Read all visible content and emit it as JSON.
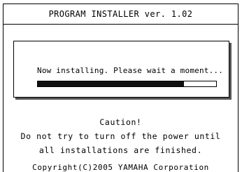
{
  "installer": {
    "title": "PROGRAM INSTALLER ver. 1.02",
    "status": "Now installing. Please wait a moment...",
    "progress_fraction": 0.82
  },
  "caution": {
    "heading": "Caution!",
    "line1": "Do not try to turn off the power until",
    "line2": "all installations are finished."
  },
  "footer": {
    "copyright": "Copyright(C)2005 YAMAHA Corporation"
  },
  "colors": {
    "background": "#ffffff",
    "foreground": "#000000",
    "progress_fill": "#111111",
    "panel_shadow": "#555555"
  }
}
